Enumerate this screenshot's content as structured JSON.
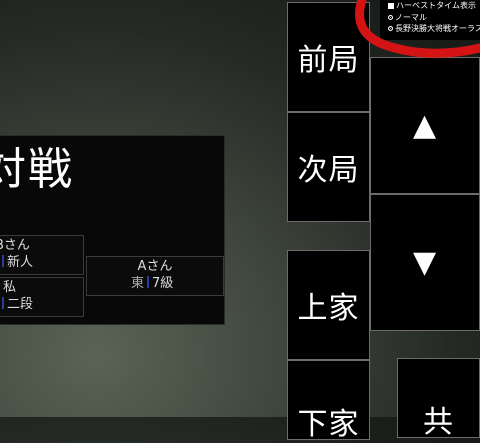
{
  "game": {
    "title": "対戦",
    "players": [
      {
        "name": "Bさん",
        "wind": "",
        "rank": "新人"
      },
      {
        "name": "私",
        "wind": "",
        "rank": "二段"
      },
      {
        "name": "Aさん",
        "wind": "東",
        "rank": "7級"
      }
    ]
  },
  "controls": {
    "prev_round": "前局",
    "next_round": "次局",
    "upper_player": "上家",
    "lower_player": "下家",
    "up_arrow": "▲",
    "down_arrow": "▼",
    "bottom_partial": "共"
  },
  "options": {
    "harvest_time": "ハーベストタイム表示",
    "normal": "ノーマル",
    "nagano": "長野決勝大将戦オーラス"
  },
  "colors": {
    "annotation_red": "#d41414",
    "rank_bar": "#2a3d9a"
  }
}
